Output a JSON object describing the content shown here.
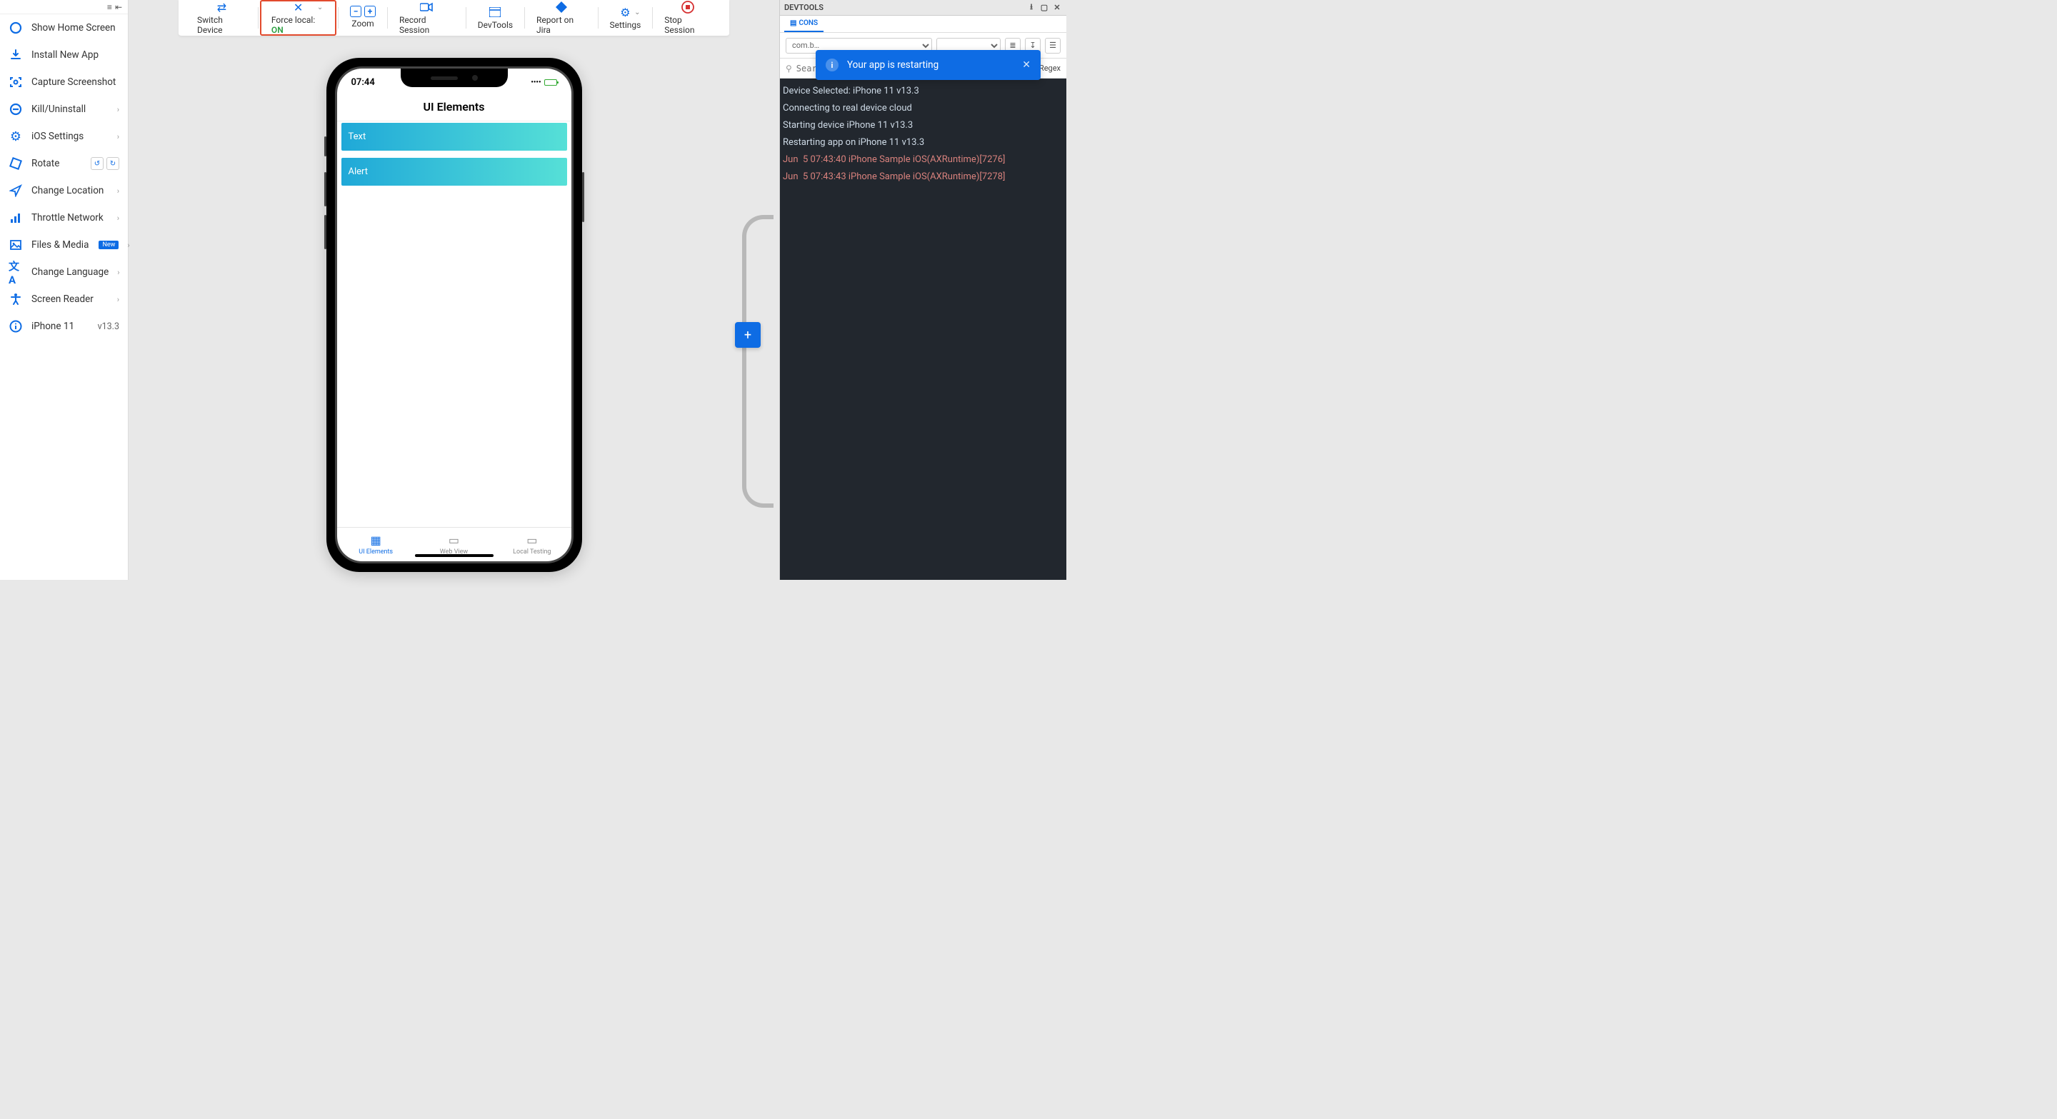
{
  "sidebar": {
    "items": [
      {
        "label": "Show Home Screen",
        "icon": "circle"
      },
      {
        "label": "Install New App",
        "icon": "download"
      },
      {
        "label": "Capture Screenshot",
        "icon": "capture"
      },
      {
        "label": "Kill/Uninstall",
        "icon": "minus-circle",
        "chevron": true
      },
      {
        "label": "iOS Settings",
        "icon": "gear",
        "chevron": true
      },
      {
        "label": "Rotate",
        "icon": "rotate",
        "rotateBtns": true
      },
      {
        "label": "Change Location",
        "icon": "navigate",
        "chevron": true
      },
      {
        "label": "Throttle Network",
        "icon": "bars",
        "chevron": true
      },
      {
        "label": "Files & Media",
        "icon": "image",
        "chevron": true,
        "badge": "New"
      },
      {
        "label": "Change Language",
        "icon": "translate",
        "chevron": true
      },
      {
        "label": "Screen Reader",
        "icon": "accessibility",
        "chevron": true
      },
      {
        "label": "iPhone 11",
        "icon": "info",
        "version": "v13.3"
      }
    ]
  },
  "toolbar": {
    "switch_device": "Switch Device",
    "force_local_label": "Force local:",
    "force_local_state": "ON",
    "zoom": "Zoom",
    "record": "Record Session",
    "devtools": "DevTools",
    "report": "Report on Jira",
    "settings": "Settings",
    "stop": "Stop Session"
  },
  "device": {
    "time": "07:44",
    "title": "UI Elements",
    "rows": [
      "Text",
      "Alert"
    ],
    "tabs": [
      {
        "label": "UI Elements",
        "active": true
      },
      {
        "label": "Web View",
        "active": false
      },
      {
        "label": "Local Testing",
        "active": false
      }
    ]
  },
  "devtools": {
    "title": "DEVTOOLS",
    "tab": "CONS",
    "select1": "com.b…",
    "search_placeholder": "Search Logs",
    "regex_label": "Regex",
    "logs": [
      {
        "text": "Device Selected: iPhone 11 v13.3",
        "warn": false
      },
      {
        "text": "Connecting to real device cloud",
        "warn": false
      },
      {
        "text": "Starting device iPhone 11 v13.3",
        "warn": false
      },
      {
        "text": "Restarting app on iPhone 11 v13.3",
        "warn": false
      },
      {
        "text": "Jun  5 07:43:40 iPhone Sample iOS(AXRuntime)[7276]",
        "warn": true
      },
      {
        "text": "Jun  5 07:43:43 iPhone Sample iOS(AXRuntime)[7278]",
        "warn": true
      }
    ]
  },
  "toast": {
    "message": "Your app is restarting"
  }
}
